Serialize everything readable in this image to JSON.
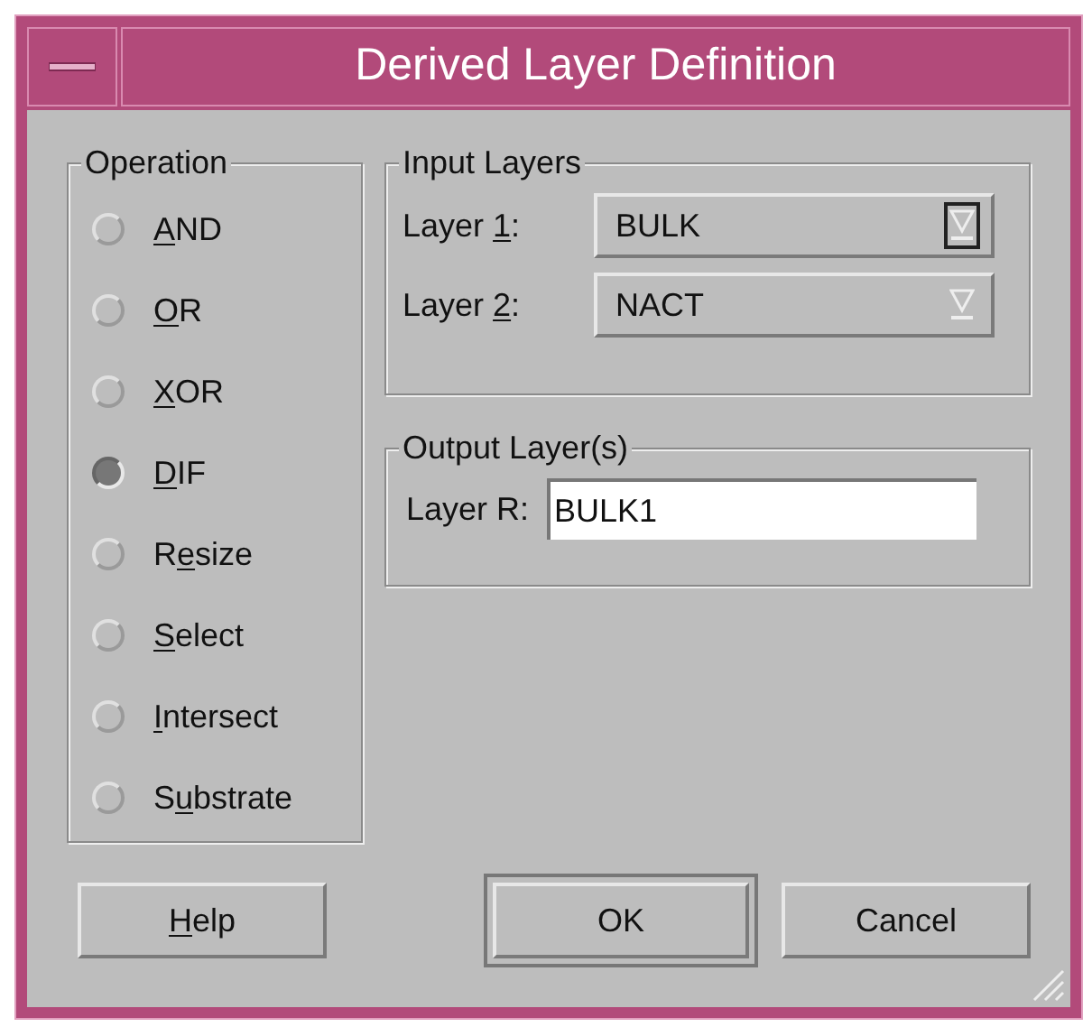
{
  "window": {
    "title": "Derived Layer Definition"
  },
  "operation": {
    "title": "Operation",
    "options": [
      {
        "label": [
          {
            "text": "A",
            "underlined": true
          },
          {
            "text": "ND",
            "underlined": false
          }
        ],
        "selected": false
      },
      {
        "label": [
          {
            "text": "O",
            "underlined": true
          },
          {
            "text": "R",
            "underlined": false
          }
        ],
        "selected": false
      },
      {
        "label": [
          {
            "text": "X",
            "underlined": true
          },
          {
            "text": "OR",
            "underlined": false
          }
        ],
        "selected": false
      },
      {
        "label": [
          {
            "text": "D",
            "underlined": true
          },
          {
            "text": "IF",
            "underlined": false
          }
        ],
        "selected": true
      },
      {
        "label": [
          {
            "text": "R",
            "underlined": false
          },
          {
            "text": "e",
            "underlined": true
          },
          {
            "text": "size",
            "underlined": false
          }
        ],
        "selected": false
      },
      {
        "label": [
          {
            "text": "S",
            "underlined": true
          },
          {
            "text": "elect",
            "underlined": false
          }
        ],
        "selected": false
      },
      {
        "label": [
          {
            "text": "I",
            "underlined": true
          },
          {
            "text": "ntersect",
            "underlined": false
          }
        ],
        "selected": false
      },
      {
        "label": [
          {
            "text": "S",
            "underlined": false
          },
          {
            "text": "u",
            "underlined": true
          },
          {
            "text": "bstrate",
            "underlined": false
          }
        ],
        "selected": false
      }
    ]
  },
  "input_layers": {
    "title": "Input Layers",
    "fields": [
      {
        "label": [
          {
            "text": "Layer ",
            "underlined": false
          },
          {
            "text": "1",
            "underlined": true
          },
          {
            "text": ":",
            "underlined": false
          }
        ],
        "value": "BULK",
        "focused": true
      },
      {
        "label": [
          {
            "text": "Layer ",
            "underlined": false
          },
          {
            "text": "2",
            "underlined": true
          },
          {
            "text": ":",
            "underlined": false
          }
        ],
        "value": "NACT",
        "focused": false
      }
    ]
  },
  "output_layers": {
    "title": "Output Layer(s)",
    "field": {
      "label": "Layer R:",
      "value": "BULK1"
    }
  },
  "buttons": [
    {
      "label": [
        {
          "text": "H",
          "underlined": true
        },
        {
          "text": "elp",
          "underlined": false
        }
      ],
      "default": false
    },
    {
      "label": [
        {
          "text": "OK",
          "underlined": false
        }
      ],
      "default": true
    },
    {
      "label": [
        {
          "text": "Cancel",
          "underlined": false
        }
      ],
      "default": false
    }
  ]
}
